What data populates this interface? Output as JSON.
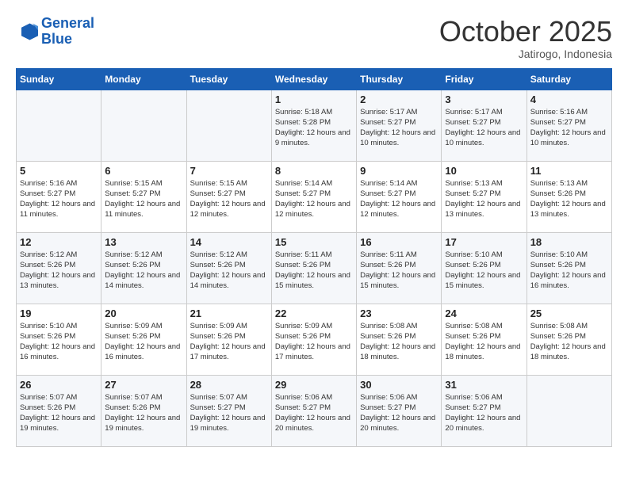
{
  "header": {
    "logo_line1": "General",
    "logo_line2": "Blue",
    "month": "October 2025",
    "location": "Jatirogo, Indonesia"
  },
  "weekdays": [
    "Sunday",
    "Monday",
    "Tuesday",
    "Wednesday",
    "Thursday",
    "Friday",
    "Saturday"
  ],
  "weeks": [
    [
      {
        "day": "",
        "sunrise": "",
        "sunset": "",
        "daylight": ""
      },
      {
        "day": "",
        "sunrise": "",
        "sunset": "",
        "daylight": ""
      },
      {
        "day": "",
        "sunrise": "",
        "sunset": "",
        "daylight": ""
      },
      {
        "day": "1",
        "sunrise": "Sunrise: 5:18 AM",
        "sunset": "Sunset: 5:28 PM",
        "daylight": "Daylight: 12 hours and 9 minutes."
      },
      {
        "day": "2",
        "sunrise": "Sunrise: 5:17 AM",
        "sunset": "Sunset: 5:27 PM",
        "daylight": "Daylight: 12 hours and 10 minutes."
      },
      {
        "day": "3",
        "sunrise": "Sunrise: 5:17 AM",
        "sunset": "Sunset: 5:27 PM",
        "daylight": "Daylight: 12 hours and 10 minutes."
      },
      {
        "day": "4",
        "sunrise": "Sunrise: 5:16 AM",
        "sunset": "Sunset: 5:27 PM",
        "daylight": "Daylight: 12 hours and 10 minutes."
      }
    ],
    [
      {
        "day": "5",
        "sunrise": "Sunrise: 5:16 AM",
        "sunset": "Sunset: 5:27 PM",
        "daylight": "Daylight: 12 hours and 11 minutes."
      },
      {
        "day": "6",
        "sunrise": "Sunrise: 5:15 AM",
        "sunset": "Sunset: 5:27 PM",
        "daylight": "Daylight: 12 hours and 11 minutes."
      },
      {
        "day": "7",
        "sunrise": "Sunrise: 5:15 AM",
        "sunset": "Sunset: 5:27 PM",
        "daylight": "Daylight: 12 hours and 12 minutes."
      },
      {
        "day": "8",
        "sunrise": "Sunrise: 5:14 AM",
        "sunset": "Sunset: 5:27 PM",
        "daylight": "Daylight: 12 hours and 12 minutes."
      },
      {
        "day": "9",
        "sunrise": "Sunrise: 5:14 AM",
        "sunset": "Sunset: 5:27 PM",
        "daylight": "Daylight: 12 hours and 12 minutes."
      },
      {
        "day": "10",
        "sunrise": "Sunrise: 5:13 AM",
        "sunset": "Sunset: 5:27 PM",
        "daylight": "Daylight: 12 hours and 13 minutes."
      },
      {
        "day": "11",
        "sunrise": "Sunrise: 5:13 AM",
        "sunset": "Sunset: 5:26 PM",
        "daylight": "Daylight: 12 hours and 13 minutes."
      }
    ],
    [
      {
        "day": "12",
        "sunrise": "Sunrise: 5:12 AM",
        "sunset": "Sunset: 5:26 PM",
        "daylight": "Daylight: 12 hours and 13 minutes."
      },
      {
        "day": "13",
        "sunrise": "Sunrise: 5:12 AM",
        "sunset": "Sunset: 5:26 PM",
        "daylight": "Daylight: 12 hours and 14 minutes."
      },
      {
        "day": "14",
        "sunrise": "Sunrise: 5:12 AM",
        "sunset": "Sunset: 5:26 PM",
        "daylight": "Daylight: 12 hours and 14 minutes."
      },
      {
        "day": "15",
        "sunrise": "Sunrise: 5:11 AM",
        "sunset": "Sunset: 5:26 PM",
        "daylight": "Daylight: 12 hours and 15 minutes."
      },
      {
        "day": "16",
        "sunrise": "Sunrise: 5:11 AM",
        "sunset": "Sunset: 5:26 PM",
        "daylight": "Daylight: 12 hours and 15 minutes."
      },
      {
        "day": "17",
        "sunrise": "Sunrise: 5:10 AM",
        "sunset": "Sunset: 5:26 PM",
        "daylight": "Daylight: 12 hours and 15 minutes."
      },
      {
        "day": "18",
        "sunrise": "Sunrise: 5:10 AM",
        "sunset": "Sunset: 5:26 PM",
        "daylight": "Daylight: 12 hours and 16 minutes."
      }
    ],
    [
      {
        "day": "19",
        "sunrise": "Sunrise: 5:10 AM",
        "sunset": "Sunset: 5:26 PM",
        "daylight": "Daylight: 12 hours and 16 minutes."
      },
      {
        "day": "20",
        "sunrise": "Sunrise: 5:09 AM",
        "sunset": "Sunset: 5:26 PM",
        "daylight": "Daylight: 12 hours and 16 minutes."
      },
      {
        "day": "21",
        "sunrise": "Sunrise: 5:09 AM",
        "sunset": "Sunset: 5:26 PM",
        "daylight": "Daylight: 12 hours and 17 minutes."
      },
      {
        "day": "22",
        "sunrise": "Sunrise: 5:09 AM",
        "sunset": "Sunset: 5:26 PM",
        "daylight": "Daylight: 12 hours and 17 minutes."
      },
      {
        "day": "23",
        "sunrise": "Sunrise: 5:08 AM",
        "sunset": "Sunset: 5:26 PM",
        "daylight": "Daylight: 12 hours and 18 minutes."
      },
      {
        "day": "24",
        "sunrise": "Sunrise: 5:08 AM",
        "sunset": "Sunset: 5:26 PM",
        "daylight": "Daylight: 12 hours and 18 minutes."
      },
      {
        "day": "25",
        "sunrise": "Sunrise: 5:08 AM",
        "sunset": "Sunset: 5:26 PM",
        "daylight": "Daylight: 12 hours and 18 minutes."
      }
    ],
    [
      {
        "day": "26",
        "sunrise": "Sunrise: 5:07 AM",
        "sunset": "Sunset: 5:26 PM",
        "daylight": "Daylight: 12 hours and 19 minutes."
      },
      {
        "day": "27",
        "sunrise": "Sunrise: 5:07 AM",
        "sunset": "Sunset: 5:26 PM",
        "daylight": "Daylight: 12 hours and 19 minutes."
      },
      {
        "day": "28",
        "sunrise": "Sunrise: 5:07 AM",
        "sunset": "Sunset: 5:27 PM",
        "daylight": "Daylight: 12 hours and 19 minutes."
      },
      {
        "day": "29",
        "sunrise": "Sunrise: 5:06 AM",
        "sunset": "Sunset: 5:27 PM",
        "daylight": "Daylight: 12 hours and 20 minutes."
      },
      {
        "day": "30",
        "sunrise": "Sunrise: 5:06 AM",
        "sunset": "Sunset: 5:27 PM",
        "daylight": "Daylight: 12 hours and 20 minutes."
      },
      {
        "day": "31",
        "sunrise": "Sunrise: 5:06 AM",
        "sunset": "Sunset: 5:27 PM",
        "daylight": "Daylight: 12 hours and 20 minutes."
      },
      {
        "day": "",
        "sunrise": "",
        "sunset": "",
        "daylight": ""
      }
    ]
  ]
}
